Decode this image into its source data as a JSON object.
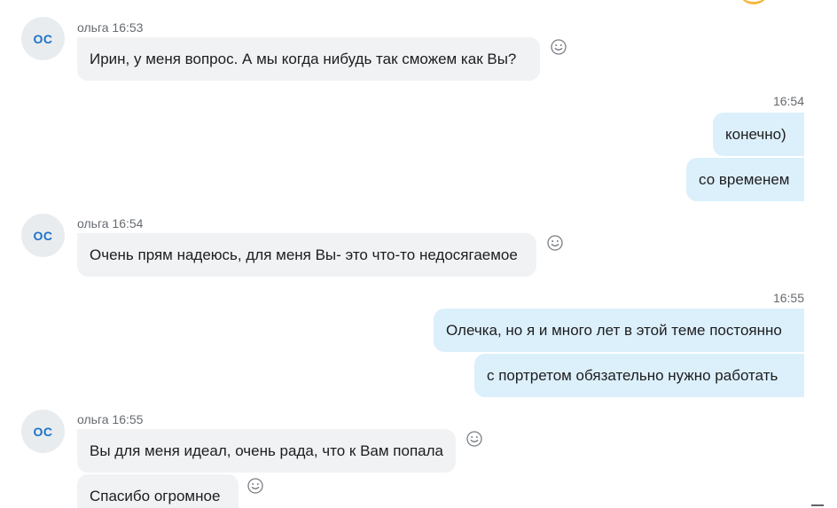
{
  "messages": [
    {
      "sender": "ольга",
      "initials": "ОС",
      "time": "16:53",
      "meta": "ольга 16:53",
      "texts": [
        "Ирин, у меня вопрос. А мы когда нибудь так сможем как Вы?"
      ]
    },
    {
      "sender": "me",
      "time": "16:54",
      "texts": [
        "конечно)",
        "со временем"
      ]
    },
    {
      "sender": "ольга",
      "initials": "ОС",
      "time": "16:54",
      "meta": "ольга 16:54",
      "texts": [
        "Очень прям надеюсь, для меня Вы- это что-то недосягаемое"
      ]
    },
    {
      "sender": "me",
      "time": "16:55",
      "texts": [
        "Олечка, но я и много лет в этой теме постоянно",
        "с портретом обязательно нужно работать"
      ]
    },
    {
      "sender": "ольга",
      "initials": "ОС",
      "time": "16:55",
      "meta": "ольга 16:55",
      "texts": [
        "Вы для меня идеал, очень рада, что к Вам попала",
        "Спасибо огромное"
      ]
    }
  ],
  "icons": {
    "reaction": "smiley-reaction-icon"
  },
  "colors": {
    "incoming_bubble": "#f0f2f4",
    "outgoing_bubble": "#dcf0fc",
    "avatar_text": "#1a73c9",
    "avatar_bg": "#e9ecef",
    "meta_text": "#666b70"
  }
}
